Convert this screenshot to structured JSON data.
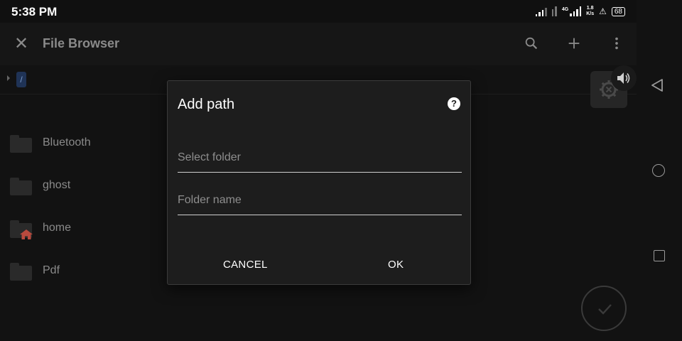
{
  "status_bar": {
    "time": "5:38 PM",
    "network_type": "4G",
    "speed_value": "1.8",
    "speed_unit": "K/s",
    "battery": "68"
  },
  "app_bar": {
    "title": "File Browser",
    "close_icon": "close-icon",
    "actions": [
      "search-icon",
      "add-icon",
      "more-vert-icon"
    ]
  },
  "path_bar": {
    "current": "/"
  },
  "files": [
    {
      "name": "Bluetooth",
      "icon": "folder-icon"
    },
    {
      "name": "ghost",
      "icon": "folder-icon"
    },
    {
      "name": "home",
      "icon": "folder-home-icon"
    },
    {
      "name": "Pdf",
      "icon": "folder-icon"
    }
  ],
  "dialog": {
    "title": "Add path",
    "help_icon": "?",
    "select_folder_placeholder": "Select folder",
    "folder_name_placeholder": "Folder name",
    "cancel_label": "CANCEL",
    "ok_label": "OK"
  },
  "colors": {
    "background": "#121212",
    "dialog_bg": "#1d1d1d",
    "path_chip": "#1f3356",
    "home_badge": "#b94a3e"
  }
}
